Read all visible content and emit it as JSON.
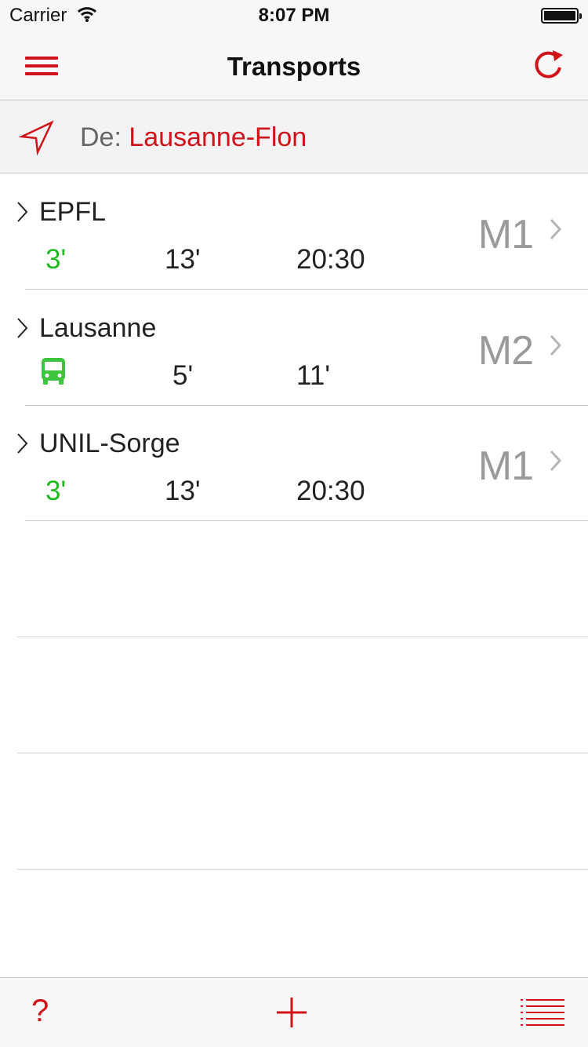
{
  "status_bar": {
    "carrier": "Carrier",
    "time": "8:07 PM"
  },
  "nav": {
    "title": "Transports",
    "menu_icon": "hamburger-icon",
    "refresh_icon": "refresh-icon"
  },
  "from": {
    "prefix": "De:",
    "station": "Lausanne-Flon",
    "icon": "location-arrow-icon"
  },
  "destinations": [
    {
      "name": "EPFL",
      "departures": [
        "3'",
        "13'",
        "20:30"
      ],
      "line": "M1",
      "first_is_bus_icon": false
    },
    {
      "name": "Lausanne",
      "departures": [
        "",
        "5'",
        "11'"
      ],
      "line": "M2",
      "first_is_bus_icon": true
    },
    {
      "name": "UNIL-Sorge",
      "departures": [
        "3'",
        "13'",
        "20:30"
      ],
      "line": "M1",
      "first_is_bus_icon": false
    }
  ],
  "toolbar": {
    "help_label": "?",
    "add_icon": "plus-icon",
    "list_icon": "list-icon"
  },
  "colors": {
    "accent": "#d0121b",
    "imminent": "#1fba1f",
    "line_code": "#9a9a9a"
  }
}
